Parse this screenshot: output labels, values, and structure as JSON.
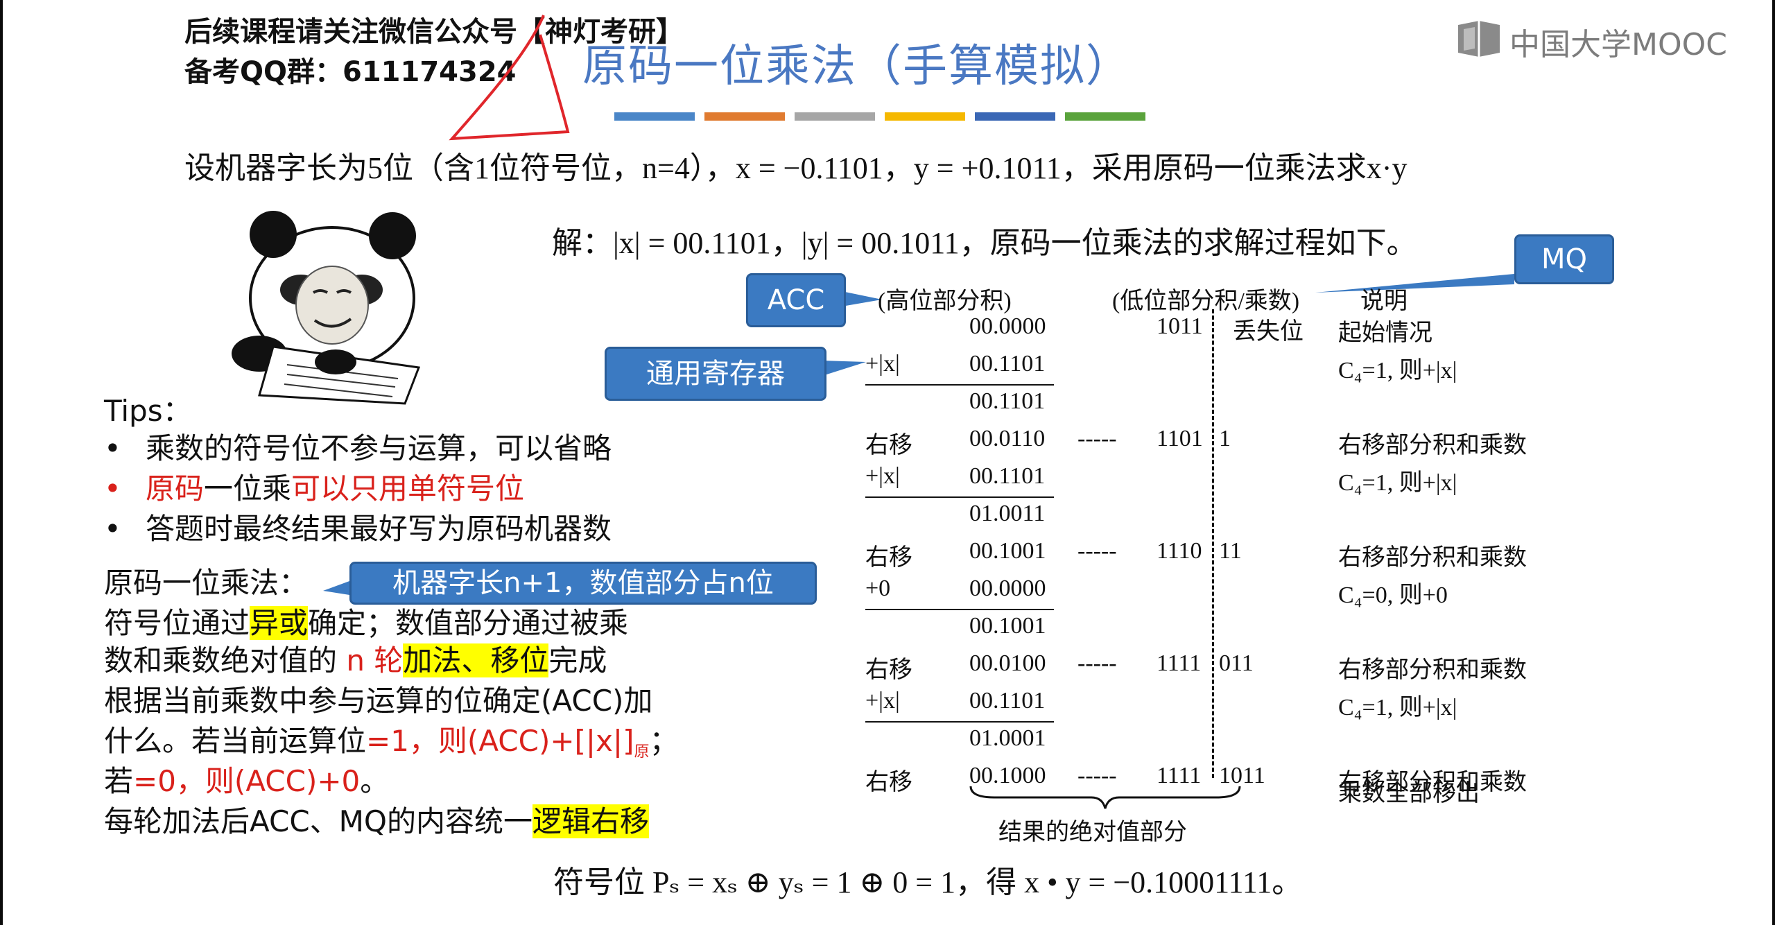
{
  "watermark": {
    "line1": "后续课程请关注微信公众号【神灯考研】",
    "line2": "备考QQ群：611174324"
  },
  "logo": {
    "text": "中国大学MOOC"
  },
  "title": "原码一位乘法（手算模拟）",
  "color_bars": [
    "#4a86c8",
    "#e07b30",
    "#a6a6a6",
    "#f5b800",
    "#3a67b5",
    "#5aa33c"
  ],
  "problem": "设机器字长为5位（含1位符号位，n=4），x = −0.1101，y = +0.1011，采用原码一位乘法求x·y",
  "solution_intro": "解：|x| = 00.1101，|y| = 00.1011，原码一位乘法的求解过程如下。",
  "callouts": {
    "mq": "MQ",
    "acc": "ACC",
    "general_register": "通用寄存器",
    "word_length": "机器字长n+1，数值部分占n位"
  },
  "table": {
    "headers": {
      "high": "(高位部分积)",
      "low": "(低位部分积/乘数)",
      "note": "说明"
    },
    "lost_bit": "丢失位",
    "dashes": "-----",
    "rows": [
      {
        "op": "",
        "acc": "00.0000",
        "mq_left": "1011",
        "mq_right": "",
        "note": "起始情况"
      },
      {
        "op": "+|x|",
        "acc": "00.1101",
        "mq_left": "",
        "mq_right": "",
        "note": "C₄=1, 则+|x|"
      },
      {
        "op": "",
        "acc": "00.1101",
        "mq_left": "",
        "mq_right": "",
        "note": ""
      },
      {
        "op": "右移",
        "acc": "00.0110",
        "mq_left": "1101",
        "mq_right": "1",
        "note": "右移部分积和乘数"
      },
      {
        "op": "+|x|",
        "acc": "00.1101",
        "mq_left": "",
        "mq_right": "",
        "note": "C₄=1, 则+|x|"
      },
      {
        "op": "",
        "acc": "01.0011",
        "mq_left": "",
        "mq_right": "",
        "note": ""
      },
      {
        "op": "右移",
        "acc": "00.1001",
        "mq_left": "1110",
        "mq_right": "11",
        "note": "右移部分积和乘数"
      },
      {
        "op": "+0",
        "acc": "00.0000",
        "mq_left": "",
        "mq_right": "",
        "note": "C₄=0, 则+0"
      },
      {
        "op": "",
        "acc": "00.1001",
        "mq_left": "",
        "mq_right": "",
        "note": ""
      },
      {
        "op": "右移",
        "acc": "00.0100",
        "mq_left": "1111",
        "mq_right": "011",
        "note": "右移部分积和乘数"
      },
      {
        "op": "+|x|",
        "acc": "00.1101",
        "mq_left": "",
        "mq_right": "",
        "note": "C₄=1, 则+|x|"
      },
      {
        "op": "",
        "acc": "01.0001",
        "mq_left": "",
        "mq_right": "",
        "note": ""
      },
      {
        "op": "右移",
        "acc": "00.1000",
        "mq_left": "1111",
        "mq_right": "1011",
        "note": "右移部分积和乘数"
      }
    ],
    "last_note2": "乘数全部移出",
    "result_label": "结果的绝对值部分"
  },
  "final_line": "符号位 Pₛ = xₛ ⊕ yₛ = 1 ⊕ 0 = 1，得 x • y = −0.10001111。",
  "tips": {
    "heading": "Tips：",
    "item1": "乘数的符号位不参与运算，可以省略",
    "item2_a": "原码",
    "item2_b": "一位乘",
    "item2_c": "可以只用单符号位",
    "item3": "答题时最终结果最好写为原码机器数"
  },
  "method": {
    "heading": "原码一位乘法：",
    "l2_a": "符号位通过",
    "l2_hl": "异或",
    "l2_b": "确定；数值部分通过被乘",
    "l3_a": "数和乘数绝对值的",
    "l3_red": " n 轮",
    "l3_hl": "加法、移位",
    "l3_b": "完成",
    "l4": "根据当前乘数中参与运算的位确定(ACC)加",
    "l5_a": "什么。若当前运算位",
    "l5_red": "=1，则(ACC)+[|x|]",
    "l5_sub": "原",
    "l5_b": "；",
    "l6_a": "若",
    "l6_red": "=0，则(ACC)+0",
    "l6_b": "。",
    "l7_a": "每轮加法后ACC、MQ的内容统一",
    "l7_hl": "逻辑右移"
  }
}
